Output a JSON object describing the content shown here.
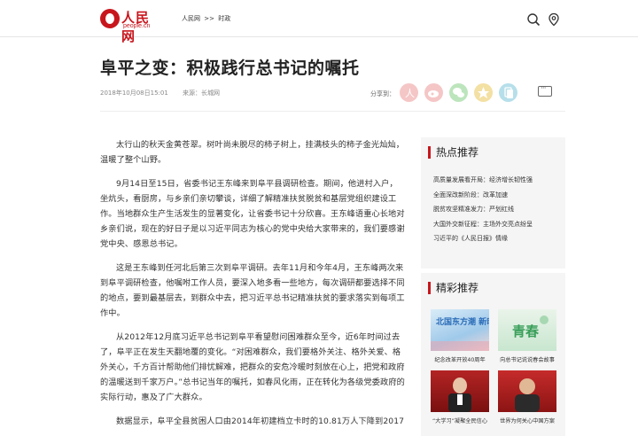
{
  "header": {
    "logo_cn": "人民网",
    "logo_en": "people.cn",
    "breadcrumb": [
      "人民网",
      ">>",
      "时政"
    ]
  },
  "article": {
    "title": "阜平之变：积极践行总书记的嘱托",
    "date": "2018年10月08日15:01",
    "source": "来源：长城网",
    "share_label": "分享到：",
    "paragraphs": [
      "太行山的秋天金黄苍翠。树叶尚未脱尽的柿子树上，挂满枝头的柿子金光灿灿，温暖了整个山野。",
      "9月14日至15日，省委书记王东峰来到阜平县调研检查。期间，他进村入户，坐炕头，看厨房，与乡亲们亲切攀谈，详细了解精准扶贫脱贫和基层党组织建设工作。当地群众生产生活发生的显著变化，让省委书记十分欣喜。王东峰语重心长地对乡亲们说，现在的好日子是以习近平同志为核心的党中央给大家带来的，我们要感谢党中央、感恩总书记。",
      "这是王东峰到任河北后第三次到阜平调研。去年11月和今年4月，王东峰两次来到阜平调研检查，他嘱咐工作人员，要深入地多看一些地方，每次调研都要选择不同的地点，要到最基层去，到群众中去，把习近平总书记精准扶贫的要求落实到每项工作中。",
      "从2012年12月底习近平总书记到阜平看望慰问困难群众至今，近6年时间过去了，阜平正在发生天翻地覆的变化。“对困难群众，我们要格外关注、格外关爱、格外关心，千方百计帮助他们排忧解难，把群众的安危冷暖时刻放在心上，把党和政府的温暖送到千家万户。”总书记当年的嘱托，如春风化雨，正在转化为各级党委政府的实际行动，惠及了广大群众。",
      "数据显示，阜平全县贫困人口由2014年初建档立卡时的10.81万人下降到2017"
    ]
  },
  "sidebar": {
    "hot_title": "热点推荐",
    "hot_items": [
      "高质量发展看开局：经济增长韧性强",
      "全面深改新阶段：改革加速",
      "脱贫攻坚精准发力：严划红线",
      "大国外交新征程：主场外交亮点纷呈",
      "习近平的《人民日报》情缘"
    ],
    "featured_title": "精彩推荐",
    "featured_items": [
      {
        "caption": "纪念改革开放40周年",
        "overlay": "北国东方潮 新时代"
      },
      {
        "caption": "向总书记说说春会故事",
        "overlay": "青春"
      },
      {
        "caption": "“大学习”凝聚全民信心",
        "overlay": ""
      },
      {
        "caption": "世界为何关心中国方案",
        "overlay": ""
      }
    ]
  },
  "colors": {
    "brand": "#c8161d",
    "share": [
      "#f2b8b8",
      "#f2b8b8",
      "#b6e2b6",
      "#f1dc9a",
      "#aadbe8"
    ]
  }
}
